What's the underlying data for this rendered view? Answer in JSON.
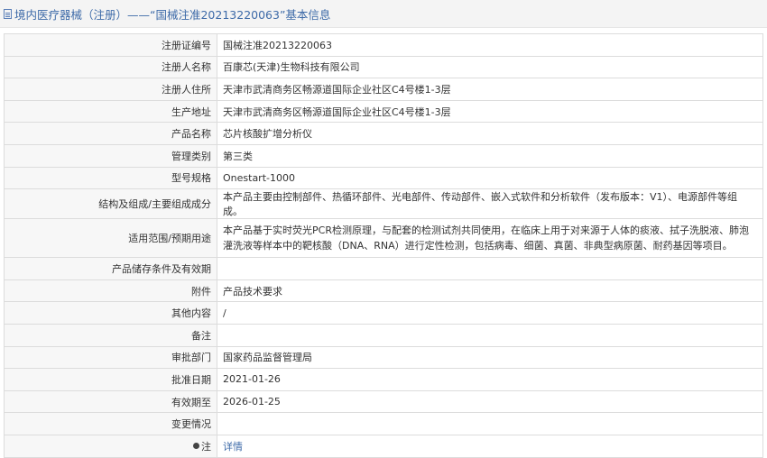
{
  "header": {
    "title": "境内医疗器械（注册）——“国械注准20213220063”基本信息"
  },
  "rows": [
    {
      "label": "注册证编号",
      "value": "国械注准20213220063"
    },
    {
      "label": "注册人名称",
      "value": "百康芯(天津)生物科技有限公司"
    },
    {
      "label": "注册人住所",
      "value": "天津市武清商务区畅源道国际企业社区C4号楼1-3层"
    },
    {
      "label": "生产地址",
      "value": "天津市武清商务区畅源道国际企业社区C4号楼1-3层"
    },
    {
      "label": "产品名称",
      "value": "芯片核酸扩增分析仪"
    },
    {
      "label": "管理类别",
      "value": "第三类"
    },
    {
      "label": "型号规格",
      "value": "Onestart-1000"
    },
    {
      "label": "结构及组成/主要组成成分",
      "value": "本产品主要由控制部件、热循环部件、光电部件、传动部件、嵌入式软件和分析软件（发布版本：V1）、电源部件等组成。"
    },
    {
      "label": "适用范围/预期用途",
      "value": "本产品基于实时荧光PCR检测原理，与配套的检测试剂共同使用，在临床上用于对来源于人体的痰液、拭子洗脱液、肺泡灌洗液等样本中的靶核酸（DNA、RNA）进行定性检测，包括病毒、细菌、真菌、非典型病原菌、耐药基因等项目。"
    },
    {
      "label": "产品储存条件及有效期",
      "value": ""
    },
    {
      "label": "附件",
      "value": "产品技术要求"
    },
    {
      "label": "其他内容",
      "value": "/"
    },
    {
      "label": "备注",
      "value": ""
    },
    {
      "label": "审批部门",
      "value": "国家药品监督管理局"
    },
    {
      "label": "批准日期",
      "value": "2021-01-26"
    },
    {
      "label": "有效期至",
      "value": "2026-01-25"
    },
    {
      "label": "变更情况",
      "value": ""
    },
    {
      "label": "注",
      "value": "详情"
    }
  ]
}
